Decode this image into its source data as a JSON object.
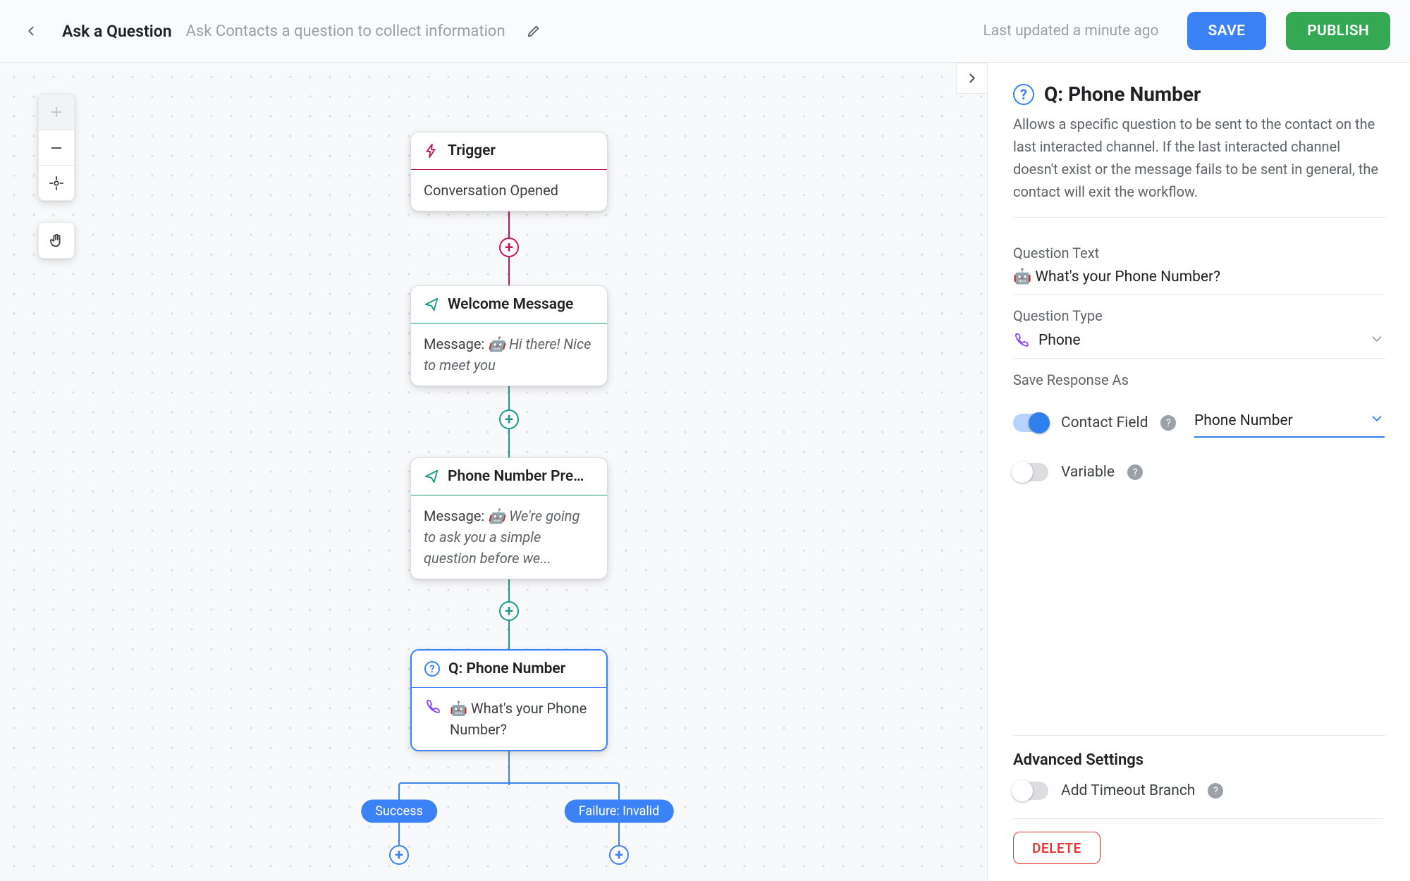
{
  "header": {
    "title": "Ask a Question",
    "subtitle": "Ask Contacts a question to collect information",
    "last_updated": "Last updated a minute ago",
    "save_label": "SAVE",
    "publish_label": "PUBLISH"
  },
  "nodes": {
    "trigger": {
      "title": "Trigger",
      "body": "Conversation Opened"
    },
    "welcome": {
      "title": "Welcome Message",
      "pre": "Message:",
      "body": "🤖 Hi there! Nice to meet you"
    },
    "premise": {
      "title": "Phone Number Premise …",
      "pre": "Message:",
      "body": "🤖 We're going to ask you a simple question before we..."
    },
    "question": {
      "title": "Q: Phone Number",
      "body": "🤖 What's your Phone Number?"
    }
  },
  "branches": {
    "success": "Success",
    "failure": "Failure: Invalid"
  },
  "side": {
    "title": "Q: Phone Number",
    "description": "Allows a specific question to be sent to the contact on the last interacted channel. If the last interacted channel doesn't exist or the message fails to be sent in general, the contact will exit the workflow.",
    "question_text_label": "Question Text",
    "question_text_value": "🤖 What's your Phone Number?",
    "question_type_label": "Question Type",
    "question_type_value": "Phone",
    "save_as_label": "Save Response As",
    "contact_field_label": "Contact Field",
    "contact_field_value": "Phone Number",
    "variable_label": "Variable",
    "advanced_label": "Advanced Settings",
    "timeout_label": "Add Timeout Branch",
    "delete_label": "DELETE"
  },
  "colors": {
    "trigger": "#c2185b",
    "message": "#1b9a8b",
    "question": "#3b82f6"
  }
}
